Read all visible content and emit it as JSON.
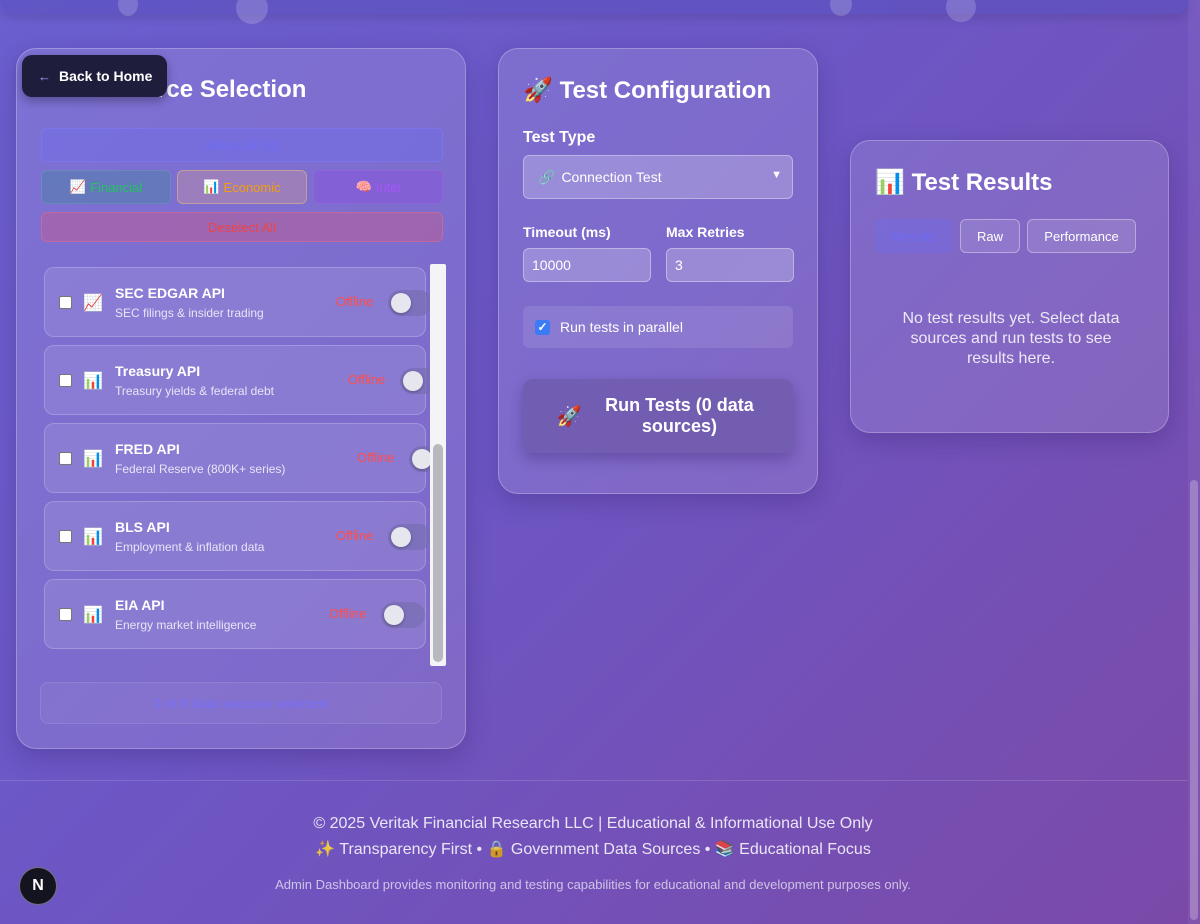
{
  "back_button": {
    "label": "Back to Home",
    "icon": "arrow-left-icon"
  },
  "data_sources": {
    "title": "Data Source Selection",
    "title_visible": "rce Selection",
    "select_all_label": "Select All (9)",
    "filters": [
      {
        "icon": "📈",
        "label": "Financial",
        "color": "#22c55e"
      },
      {
        "icon": "📊",
        "label": "Economic",
        "color": "#f59e0b"
      },
      {
        "icon": "🧠",
        "label": "Intel",
        "color": "#a855f7"
      }
    ],
    "deselect_all_label": "Deselect All",
    "items": [
      {
        "icon": "📈",
        "name": "SEC EDGAR API",
        "desc": "SEC filings & insider trading",
        "status": "Offline",
        "checked": false,
        "enabled": false
      },
      {
        "icon": "📊",
        "name": "Treasury API",
        "desc": "Treasury yields & federal debt",
        "status": "Offline",
        "checked": false,
        "enabled": false
      },
      {
        "icon": "📊",
        "name": "FRED API",
        "desc": "Federal Reserve (800K+ series)",
        "status": "Offline",
        "checked": false,
        "enabled": false
      },
      {
        "icon": "📊",
        "name": "BLS API",
        "desc": "Employment & inflation data",
        "status": "Offline",
        "checked": false,
        "enabled": false
      },
      {
        "icon": "📊",
        "name": "EIA API",
        "desc": "Energy market intelligence",
        "status": "Offline",
        "checked": false,
        "enabled": false
      }
    ],
    "selected_count_text": "0 of 9 data sources selected",
    "status_color": "#ff4d4d"
  },
  "config": {
    "icon": "🚀",
    "title": "Test Configuration",
    "test_type_label": "Test Type",
    "test_type_value_icon": "🔗",
    "test_type_value": "Connection Test",
    "timeout_label": "Timeout (ms)",
    "timeout_value": "10000",
    "retries_label": "Max Retries",
    "retries_value": "3",
    "parallel_label": "Run tests in parallel",
    "parallel_checked": true,
    "run_icon": "🚀",
    "run_label": "Run Tests (0 data sources)"
  },
  "results": {
    "icon": "📊",
    "title": "Test Results",
    "tabs": [
      "Results",
      "Raw",
      "Performance"
    ],
    "active_tab": "Results",
    "empty_message": "No test results yet. Select data sources and run tests to see results here."
  },
  "footer": {
    "copyright": "© 2025 Veritak Financial Research LLC | Educational & Informational Use Only",
    "tagline": "✨ Transparency First • 🔒 Government Data Sources • 📚 Educational Focus",
    "disclaimer": "Admin Dashboard provides monitoring and testing capabilities for educational and development purposes only."
  },
  "nextjs_badge": "N"
}
